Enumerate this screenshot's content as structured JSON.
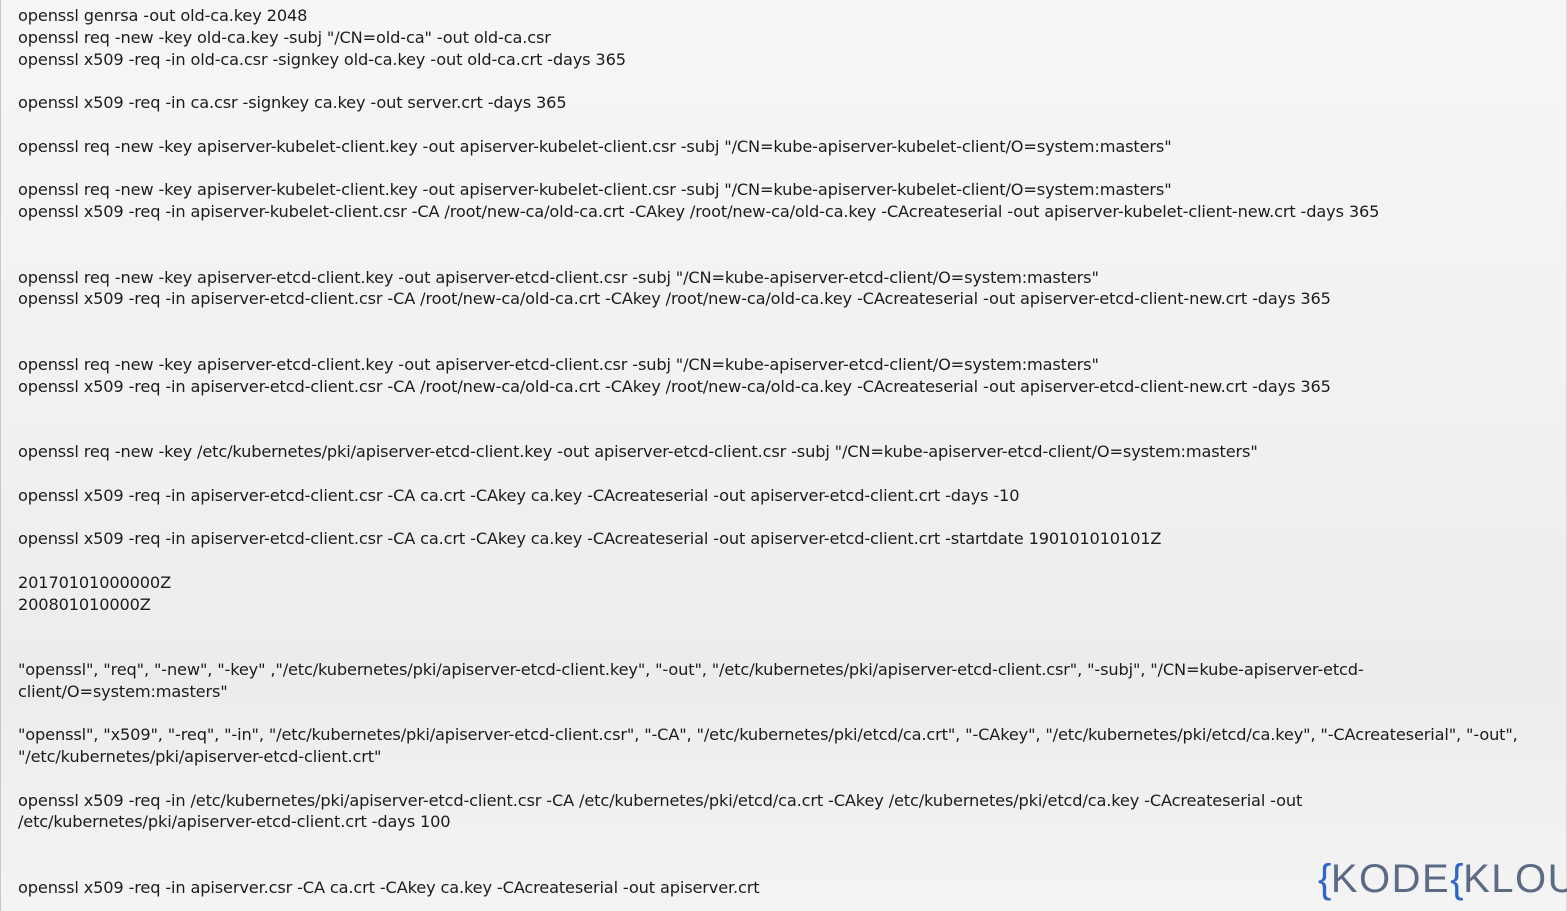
{
  "notes": {
    "lines": [
      "openssl genrsa -out old-ca.key 2048",
      "openssl req -new -key old-ca.key -subj \"/CN=old-ca\" -out old-ca.csr",
      "openssl x509 -req -in old-ca.csr -signkey old-ca.key -out old-ca.crt -days 365",
      "",
      "openssl x509 -req -in ca.csr -signkey ca.key -out server.crt -days 365",
      "",
      "openssl req -new -key apiserver-kubelet-client.key -out apiserver-kubelet-client.csr -subj \"/CN=kube-apiserver-kubelet-client/O=system:masters\"",
      "",
      "openssl req -new -key apiserver-kubelet-client.key -out apiserver-kubelet-client.csr -subj \"/CN=kube-apiserver-kubelet-client/O=system:masters\"",
      "openssl x509 -req -in apiserver-kubelet-client.csr -CA /root/new-ca/old-ca.crt -CAkey /root/new-ca/old-ca.key -CAcreateserial -out apiserver-kubelet-client-new.crt -days 365",
      "",
      "",
      "openssl req -new -key apiserver-etcd-client.key -out apiserver-etcd-client.csr -subj \"/CN=kube-apiserver-etcd-client/O=system:masters\"",
      "openssl x509 -req -in apiserver-etcd-client.csr -CA /root/new-ca/old-ca.crt -CAkey /root/new-ca/old-ca.key -CAcreateserial -out apiserver-etcd-client-new.crt -days 365",
      "",
      "",
      "openssl req -new -key apiserver-etcd-client.key -out apiserver-etcd-client.csr -subj \"/CN=kube-apiserver-etcd-client/O=system:masters\"",
      "openssl x509 -req -in apiserver-etcd-client.csr -CA /root/new-ca/old-ca.crt -CAkey /root/new-ca/old-ca.key -CAcreateserial -out apiserver-etcd-client-new.crt -days 365",
      "",
      "",
      "openssl req -new -key /etc/kubernetes/pki/apiserver-etcd-client.key -out apiserver-etcd-client.csr -subj \"/CN=kube-apiserver-etcd-client/O=system:masters\"",
      "",
      "openssl x509 -req -in apiserver-etcd-client.csr -CA ca.crt -CAkey ca.key -CAcreateserial -out apiserver-etcd-client.crt -days -10",
      "",
      "openssl x509 -req -in apiserver-etcd-client.csr -CA ca.crt -CAkey ca.key -CAcreateserial -out apiserver-etcd-client.crt -startdate 190101010101Z",
      "",
      "20170101000000Z",
      "200801010000Z",
      "",
      "",
      "\"openssl\", \"req\", \"-new\", \"-key\" ,\"/etc/kubernetes/pki/apiserver-etcd-client.key\", \"-out\", \"/etc/kubernetes/pki/apiserver-etcd-client.csr\", \"-subj\", \"/CN=kube-apiserver-etcd-",
      "client/O=system:masters\"",
      "",
      "\"openssl\", \"x509\", \"-req\", \"-in\", \"/etc/kubernetes/pki/apiserver-etcd-client.csr\", \"-CA\", \"/etc/kubernetes/pki/etcd/ca.crt\", \"-CAkey\", \"/etc/kubernetes/pki/etcd/ca.key\", \"-CAcreateserial\", \"-out\",",
      "\"/etc/kubernetes/pki/apiserver-etcd-client.crt\"",
      "",
      "openssl x509 -req -in /etc/kubernetes/pki/apiserver-etcd-client.csr -CA /etc/kubernetes/pki/etcd/ca.crt -CAkey /etc/kubernetes/pki/etcd/ca.key -CAcreateserial -out",
      "/etc/kubernetes/pki/apiserver-etcd-client.crt -days 100",
      "",
      "",
      "openssl x509 -req -in apiserver.csr -CA ca.crt -CAkey ca.key -CAcreateserial -out apiserver.crt"
    ]
  },
  "logo": {
    "text": "KODEKLOUD",
    "color_primary": "#5b6b86",
    "color_accent": "#2f66c8"
  }
}
